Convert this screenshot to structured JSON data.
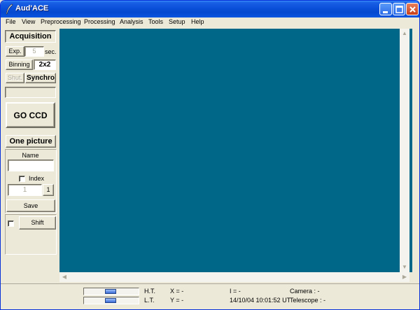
{
  "window": {
    "title": "Aud'ACE",
    "icon": "feather-icon",
    "minimize_icon": "minimize-icon",
    "maximize_icon": "maximize-icon",
    "close_icon": "close-icon"
  },
  "menu": [
    "File",
    "View",
    "Preprocessing",
    "Processing",
    "Analysis",
    "Tools",
    "Setup",
    "Help"
  ],
  "acquisition": {
    "header": "Acquisition",
    "exp_button": "Exp.",
    "exp_value": "5",
    "exp_unit": "sec.",
    "binning_button": "Binning",
    "binning_value": "2x2",
    "shut_button": "Shut.",
    "synchro_button": "Synchro",
    "go_button": "GO CCD"
  },
  "picture": {
    "mode_button": "One picture",
    "name_label": "Name",
    "name_value": "",
    "index_label": "Index",
    "index_checked": false,
    "index_value": "1",
    "index_step": "1",
    "save_button": "Save",
    "shift_button": "Shift",
    "shift_checked": false
  },
  "image_area": {
    "background": "#006788"
  },
  "status": {
    "ht_label": "H.T.",
    "lt_label": "L.T.",
    "ht_level": 0.5,
    "lt_level": 0.5,
    "x_readout": "X = -",
    "y_readout": "Y = -",
    "i_readout": "I = -",
    "datetime": "14/10/04 10:01:52 UT",
    "camera": "Camera : -",
    "telescope": "Telescope : -"
  }
}
